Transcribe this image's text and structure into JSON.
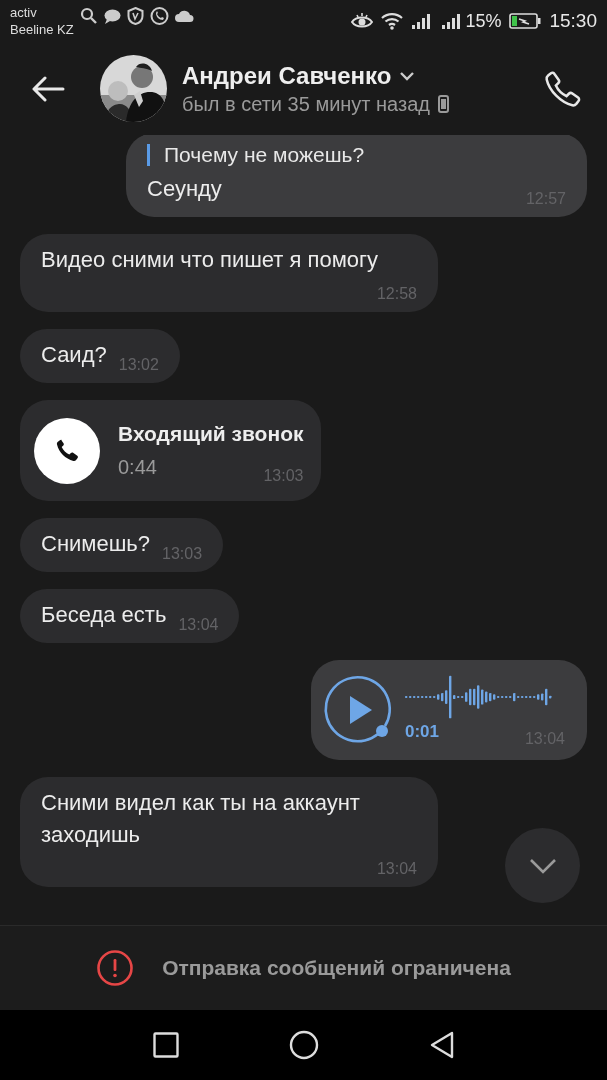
{
  "status_bar": {
    "operator": "activ",
    "carrier": "Beeline KZ",
    "battery": "15%",
    "time": "15:30"
  },
  "header": {
    "name": "Андреи Савченко",
    "status": "был в сети 35 минут назад"
  },
  "messages": [
    {
      "kind": "text",
      "outgoing": true,
      "quote": "Почему не можешь?",
      "text": "Сеунду",
      "time": "12:57"
    },
    {
      "kind": "text",
      "outgoing": false,
      "text": "Видео сними что пишет я помогу",
      "time": "12:58"
    },
    {
      "kind": "text",
      "outgoing": false,
      "text": "Саид?",
      "time": "13:02"
    },
    {
      "kind": "call",
      "outgoing": false,
      "title": "Входящий звонок",
      "duration": "0:44",
      "time": "13:03"
    },
    {
      "kind": "text",
      "outgoing": false,
      "text": "Снимешь?",
      "time": "13:03"
    },
    {
      "kind": "text",
      "outgoing": false,
      "text": "Беседа есть",
      "time": "13:04"
    },
    {
      "kind": "voice",
      "outgoing": true,
      "duration": "0:01",
      "time": "13:04"
    },
    {
      "kind": "text",
      "outgoing": false,
      "text": "Сними видел как ты на аккаунт заходишь",
      "time": "13:04"
    }
  ],
  "notice": "Отправка сообщений ограничена"
}
